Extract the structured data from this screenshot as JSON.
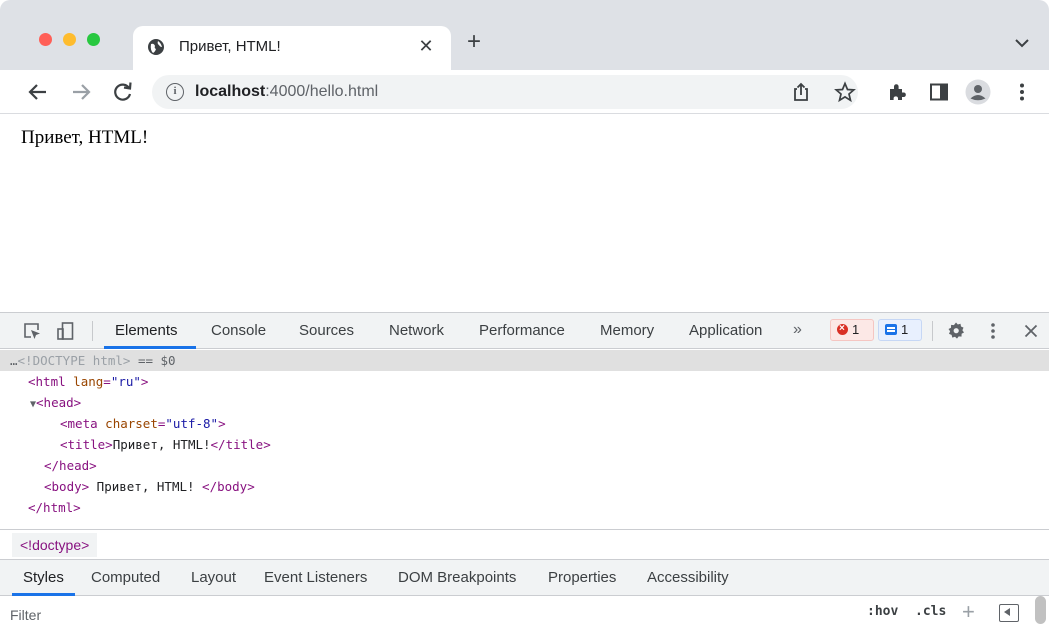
{
  "window": {
    "tab_title": "Привет, HTML!",
    "tab_close": "✕",
    "new_tab": "+"
  },
  "toolbar": {
    "url_host": "localhost",
    "url_path": ":4000/hello.html",
    "info_glyph": "i"
  },
  "page": {
    "heading": "Привет, HTML!"
  },
  "devtools": {
    "tabs": [
      "Elements",
      "Console",
      "Sources",
      "Network",
      "Performance",
      "Memory",
      "Application"
    ],
    "more": "»",
    "error_count": "1",
    "message_count": "1",
    "dom": {
      "doctype": "<!DOCTYPE html>",
      "selected_marker": "== $0",
      "html_open_tag": "<html",
      "html_lang_attr": "lang",
      "html_lang_value": "\"ru\"",
      "head_open": "<head>",
      "meta_tag": "<meta",
      "meta_attr": "charset",
      "meta_value": "\"utf-8\"",
      "title_open": "<title>",
      "title_text": "Привет, HTML!",
      "title_close": "</title>",
      "head_close": "</head>",
      "body_open": "<body>",
      "body_text": " Привет, HTML! ",
      "body_close": "</body>",
      "html_close": "</html>"
    },
    "breadcrumb": "<!doctype>",
    "styles_tabs": [
      "Styles",
      "Computed",
      "Layout",
      "Event Listeners",
      "DOM Breakpoints",
      "Properties",
      "Accessibility"
    ],
    "filter": {
      "placeholder": "Filter",
      "hov": ":hov",
      "cls": ".cls",
      "plus": "+"
    }
  },
  "colors": {
    "accent": "#1a73e8",
    "tag": "#881280",
    "attr": "#994500",
    "attr_value": "#1a1aa6",
    "error": "#d93025"
  },
  "icons": [
    "globe-icon",
    "close-icon",
    "plus-icon",
    "chevron-down-icon",
    "back-arrow-icon",
    "forward-arrow-icon",
    "reload-icon",
    "info-icon",
    "share-icon",
    "star-icon",
    "extensions-icon",
    "side-panel-icon",
    "profile-icon",
    "kebab-menu-icon",
    "inspect-icon",
    "device-toolbar-icon",
    "gear-icon",
    "error-icon",
    "message-icon",
    "toggle-sidebar-icon"
  ]
}
